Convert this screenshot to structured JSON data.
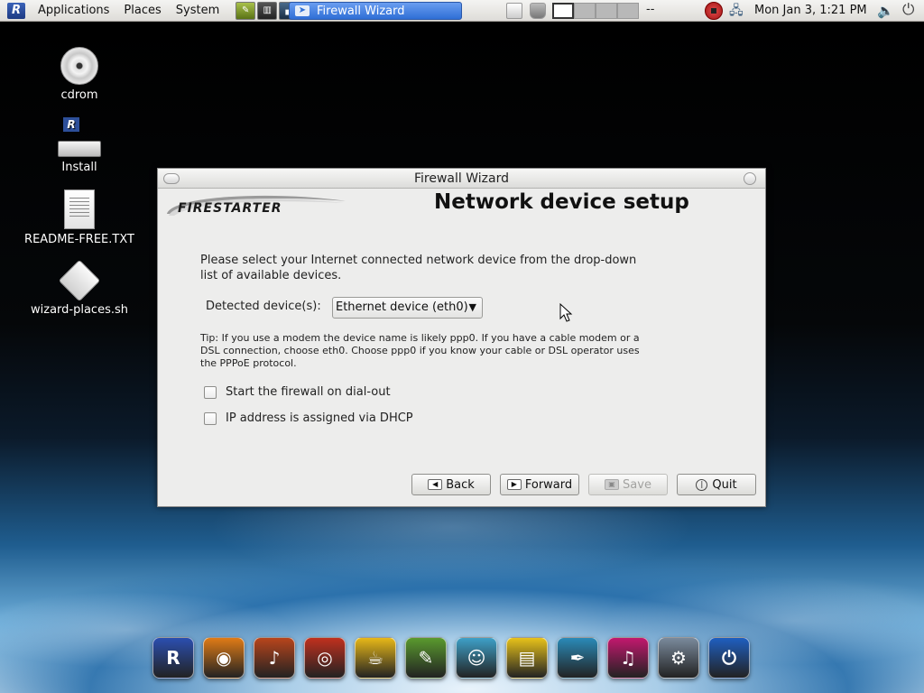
{
  "top_panel": {
    "menus": [
      "Applications",
      "Places",
      "System"
    ],
    "task_button": "Firewall Wizard",
    "workspace_dash": "--",
    "clock": "Mon Jan  3,  1:21 PM"
  },
  "desktop_icons": [
    {
      "label": "cdrom",
      "icon": "cdrom-icon"
    },
    {
      "label": "Install",
      "icon": "install-icon"
    },
    {
      "label": "README-FREE.TXT",
      "icon": "text-file-icon"
    },
    {
      "label": "wizard-places.sh",
      "icon": "script-file-icon"
    }
  ],
  "window": {
    "title": "Firewall Wizard",
    "logo_text": "FIRESTARTER",
    "heading": "Network device setup",
    "intro_line1": "Please select your Internet connected network device from the drop-down",
    "intro_line2": "list of available devices.",
    "detected_label": "Detected device(s):",
    "detected_value": "Ethernet device (eth0)",
    "tip_line1": "Tip: If you use a modem the device name is likely ppp0. If you have a cable modem or a",
    "tip_line2": "DSL connection, choose eth0. Choose ppp0 if you know your cable or DSL operator uses",
    "tip_line3": "the PPPoE protocol.",
    "checkbox_dialout": "Start the firewall on dial-out",
    "checkbox_dhcp": "IP address is assigned via DHCP",
    "btn_back": "Back",
    "btn_forward": "Forward",
    "btn_save": "Save",
    "btn_quit": "Quit"
  },
  "dock": [
    {
      "icon": "dock-home-icon",
      "color": "#2b4fb0"
    },
    {
      "icon": "dock-firefox-icon",
      "color": "#e07b16"
    },
    {
      "icon": "dock-guitar-icon",
      "color": "#b8451c"
    },
    {
      "icon": "dock-burner-icon",
      "color": "#c0301e"
    },
    {
      "icon": "dock-coffee-icon",
      "color": "#e8b818"
    },
    {
      "icon": "dock-photo-icon",
      "color": "#5a9a2e"
    },
    {
      "icon": "dock-messenger-icon",
      "color": "#3ea0c8"
    },
    {
      "icon": "dock-office-icon",
      "color": "#e8c21a"
    },
    {
      "icon": "dock-feather-icon",
      "color": "#2a8ab8"
    },
    {
      "icon": "dock-music-icon",
      "color": "#c2186e"
    },
    {
      "icon": "dock-settings-icon",
      "color": "#7a8a9c"
    },
    {
      "icon": "dock-power-icon",
      "color": "#1f5fc0"
    }
  ]
}
